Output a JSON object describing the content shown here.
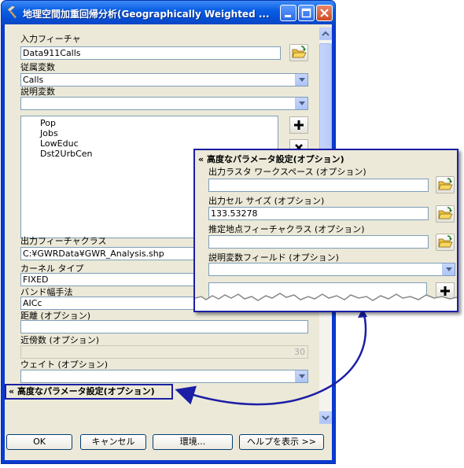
{
  "window": {
    "title": "地理空間加重回帰分析(Geographically Weighted ..."
  },
  "form": {
    "input_features": {
      "label": "入力フィーチャ",
      "value": "Data911Calls"
    },
    "dependent_variable": {
      "label": "従属変数",
      "value": "Calls"
    },
    "explanatory_variables": {
      "label": "説明変数",
      "value": "",
      "items": [
        "Pop",
        "Jobs",
        "LowEduc",
        "Dst2UrbCen"
      ]
    },
    "output_feature_class": {
      "label": "出力フィーチャクラス",
      "value": "C:¥GWRData¥GWR_Analysis.shp"
    },
    "kernel_type": {
      "label": "カーネル タイプ",
      "value": "FIXED"
    },
    "bandwidth_method": {
      "label": "バンド幅手法",
      "value": "AICc"
    },
    "distance": {
      "label": "距離 (オプション)",
      "value": ""
    },
    "neighbors": {
      "label": "近傍数 (オプション)",
      "value": "30"
    },
    "weight": {
      "label": "ウェイト (オプション)",
      "value": ""
    },
    "advanced_toggle": {
      "chevron": "«",
      "label": "高度なパラメータ設定(オプション)"
    }
  },
  "buttons": {
    "ok": "OK",
    "cancel": "キャンセル",
    "environments": "環境...",
    "show_help": "ヘルプを表示 >>"
  },
  "callout": {
    "header": "高度なパラメータ設定(オプション)",
    "raster_workspace": {
      "label": "出力ラスタ ワークスペース (オプション)",
      "value": ""
    },
    "cell_size": {
      "label": "出力セル サイズ (オプション)",
      "value": "133.53278"
    },
    "prediction_locations": {
      "label": "推定地点フィーチャクラス (オプション)",
      "value": ""
    },
    "explanatory_field": {
      "label": "説明変数フィールド (オプション)",
      "value": ""
    }
  },
  "colors": {
    "title_bar": "#0a5fe4",
    "dialog_bg": "#ece9d8",
    "highlight_border": "#1b1fa5"
  }
}
